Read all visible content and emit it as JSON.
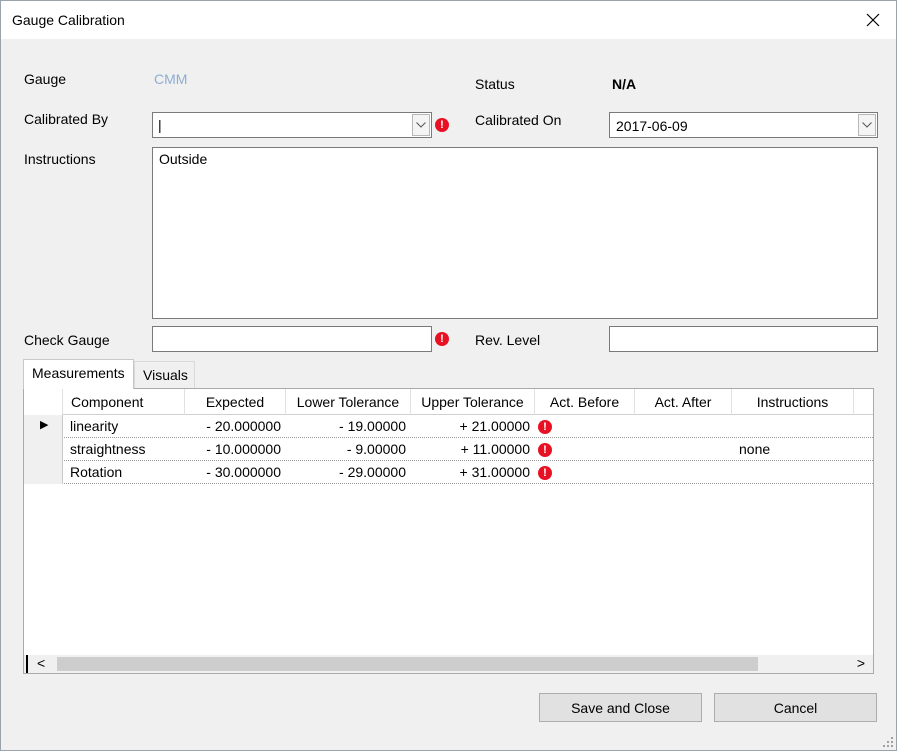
{
  "window": {
    "title": "Gauge Calibration",
    "close_icon": "close-icon"
  },
  "form": {
    "gauge_label": "Gauge",
    "gauge_value": "CMM",
    "status_label": "Status",
    "status_value": "N/A",
    "calibrated_by_label": "Calibrated By",
    "calibrated_by_value": "|",
    "calibrated_on_label": "Calibrated On",
    "calibrated_on_value": "2017-06-09",
    "instructions_label": "Instructions",
    "instructions_value": "Outside",
    "check_gauge_label": "Check Gauge",
    "check_gauge_value": "",
    "rev_level_label": "Rev. Level",
    "rev_level_value": "",
    "error_icon": "!",
    "error_color": "#e81123"
  },
  "tabs": [
    {
      "label": "Measurements",
      "active": true
    },
    {
      "label": "Visuals",
      "active": false
    }
  ],
  "grid": {
    "columns": [
      "Component",
      "Expected",
      "Lower Tolerance",
      "Upper Tolerance",
      "Act. Before",
      "Act. After",
      "Instructions"
    ],
    "rows": [
      {
        "selected": true,
        "component": "linearity",
        "expected": "- 20.000000",
        "lower": "- 19.00000",
        "upper": "+ 21.00000",
        "act_before": "",
        "act_after": "",
        "instructions": "",
        "error": true
      },
      {
        "selected": false,
        "component": "straightness",
        "expected": "- 10.000000",
        "lower": "- 9.00000",
        "upper": "+ 11.00000",
        "act_before": "",
        "act_after": "",
        "instructions": "none",
        "error": true
      },
      {
        "selected": false,
        "component": "Rotation",
        "expected": "- 30.000000",
        "lower": "- 29.00000",
        "upper": "+ 31.00000",
        "act_before": "",
        "act_after": "",
        "instructions": "",
        "error": true
      }
    ],
    "row_indicator": "▶",
    "scroll_left": "<",
    "scroll_right": ">"
  },
  "buttons": {
    "save_close": "Save and Close",
    "cancel": "Cancel"
  }
}
